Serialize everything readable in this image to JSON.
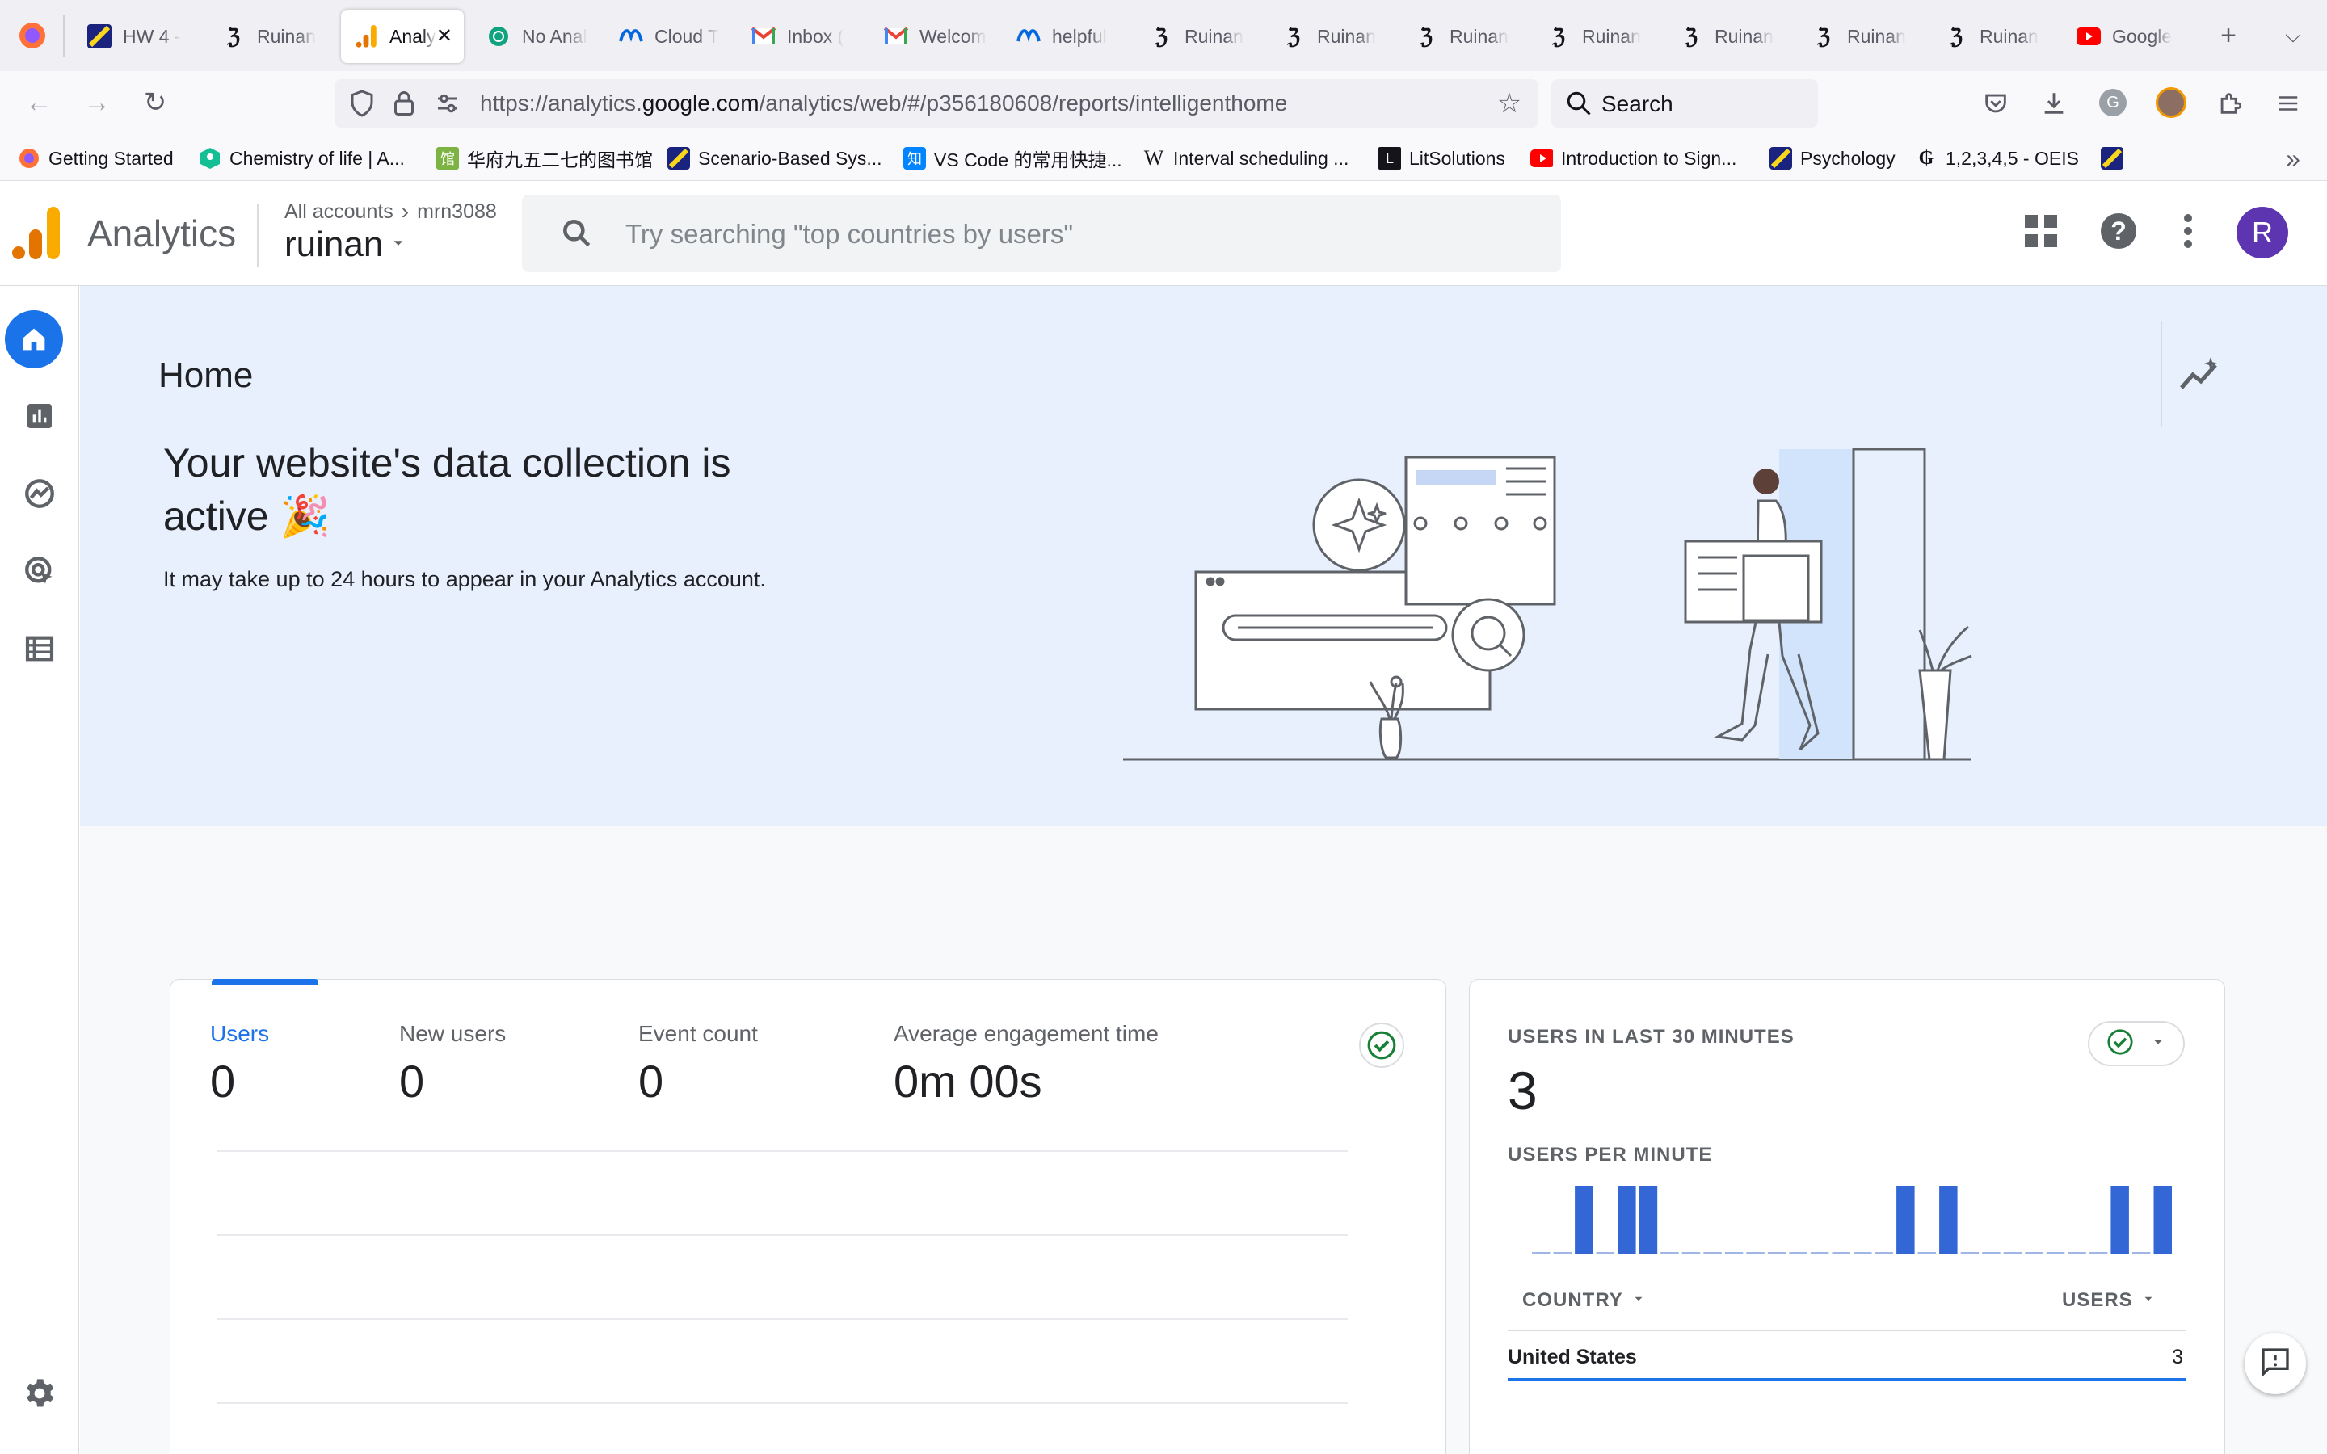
{
  "browser": {
    "tabs": [
      {
        "label": "HW 4 -",
        "icon": "stripe-icon",
        "active": false
      },
      {
        "label": "Ruinan",
        "icon": "dopamine-icon",
        "active": false
      },
      {
        "label": "Analy",
        "icon": "analytics-icon",
        "active": true
      },
      {
        "label": "No Anal",
        "icon": "chatgpt-icon",
        "active": false
      },
      {
        "label": "Cloud T",
        "icon": "meta-icon",
        "active": false
      },
      {
        "label": "Inbox (",
        "icon": "gmail-icon",
        "active": false
      },
      {
        "label": "Welcom",
        "icon": "gmail-icon",
        "active": false
      },
      {
        "label": "helpful",
        "icon": "meta-icon",
        "active": false
      },
      {
        "label": "Ruinan",
        "icon": "dopamine-icon",
        "active": false
      },
      {
        "label": "Ruinan",
        "icon": "dopamine-icon",
        "active": false
      },
      {
        "label": "Ruinan",
        "icon": "dopamine-icon",
        "active": false
      },
      {
        "label": "Ruinan",
        "icon": "dopamine-icon",
        "active": false
      },
      {
        "label": "Ruinan",
        "icon": "dopamine-icon",
        "active": false
      },
      {
        "label": "Ruinan",
        "icon": "dopamine-icon",
        "active": false
      },
      {
        "label": "Ruinan",
        "icon": "dopamine-icon",
        "active": false
      },
      {
        "label": "Google",
        "icon": "youtube-icon",
        "active": false
      }
    ],
    "url": {
      "prefix": "https://analytics.",
      "domain": "google.com",
      "path": "/analytics/web/#/p356180608/reports/intelligenthome"
    },
    "search_placeholder": "Search",
    "bookmarks": [
      {
        "label": "Getting Started",
        "icon": "firefox-icon"
      },
      {
        "label": "Chemistry of life | A...",
        "icon": "khan-icon"
      },
      {
        "label": "华府九五二七的图书馆",
        "icon": "library-icon"
      },
      {
        "label": "Scenario-Based Sys...",
        "icon": "stripe-icon"
      },
      {
        "label": "VS Code 的常用快捷...",
        "icon": "zhihu-icon"
      },
      {
        "label": "Interval scheduling ...",
        "icon": "wikipedia-icon"
      },
      {
        "label": "LitSolutions",
        "icon": "lit-icon"
      },
      {
        "label": "Introduction to Sign...",
        "icon": "youtube-icon"
      },
      {
        "label": "Psychology",
        "icon": "stripe-icon"
      },
      {
        "label": "1,2,3,4,5 - OEIS",
        "icon": "oeis-icon"
      },
      {
        "label": "",
        "icon": "stripe-icon"
      }
    ]
  },
  "ga": {
    "product": "Analytics",
    "breadcrumb": {
      "all_accounts": "All accounts",
      "account": "mrn3088"
    },
    "property": "ruinan",
    "search_placeholder": "Try searching \"top countries by users\"",
    "avatar_letter": "R",
    "home_title": "Home",
    "hero": {
      "headline_line1": "Your website's data collection is",
      "headline_line2": "active",
      "emoji": "🎉",
      "subtext": "It may take up to 24 hours to appear in your Analytics account."
    },
    "metrics": [
      {
        "label": "Users",
        "value": "0",
        "selected": true
      },
      {
        "label": "New users",
        "value": "0",
        "selected": false
      },
      {
        "label": "Event count",
        "value": "0",
        "selected": false
      },
      {
        "label": "Average engagement time",
        "value": "0m 00s",
        "selected": false
      }
    ],
    "realtime": {
      "title": "USERS IN LAST 30 MINUTES",
      "count": "3",
      "subtitle": "USERS PER MINUTE",
      "col_country": "COUNTRY",
      "col_users": "USERS",
      "rows": [
        {
          "country": "United States",
          "users": "3"
        }
      ]
    },
    "colors": {
      "brand_blue": "#1a73e8",
      "bar_blue": "#3367d6",
      "hero_bg": "#e8f0fe",
      "avatar": "#5e35b1"
    }
  },
  "chart_data": {
    "type": "bar",
    "title": "USERS PER MINUTE",
    "x": [
      1,
      2,
      3,
      4,
      5,
      6,
      7,
      8,
      9,
      10,
      11,
      12,
      13,
      14,
      15,
      16,
      17,
      18,
      19,
      20,
      21,
      22,
      23,
      24,
      25,
      26,
      27,
      28,
      29,
      30
    ],
    "values": [
      0,
      0,
      1,
      0,
      1,
      1,
      0,
      0,
      0,
      0,
      0,
      0,
      0,
      0,
      0,
      0,
      0,
      1,
      0,
      1,
      0,
      0,
      0,
      0,
      0,
      0,
      0,
      1,
      0,
      1
    ],
    "ylim": [
      0,
      1
    ]
  }
}
